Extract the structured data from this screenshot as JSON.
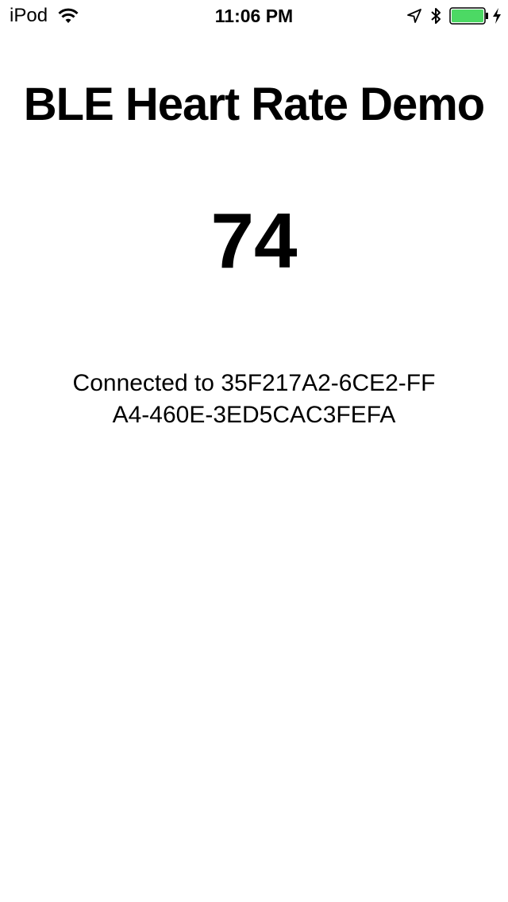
{
  "status_bar": {
    "carrier": "iPod",
    "time": "11:06 PM",
    "wifi_icon": "wifi-icon",
    "location_icon": "location-arrow-icon",
    "bluetooth_icon": "bluetooth-icon",
    "battery_icon": "battery-icon",
    "charging_icon": "charging-bolt-icon",
    "battery_level": 1.0,
    "battery_color": "#4cd964"
  },
  "main": {
    "title": "BLE Heart Rate Demo",
    "heart_rate": "74",
    "connection_status": "Connected to 35F217A2-6CE2-FFA4-460E-3ED5CAC3FEFA"
  }
}
